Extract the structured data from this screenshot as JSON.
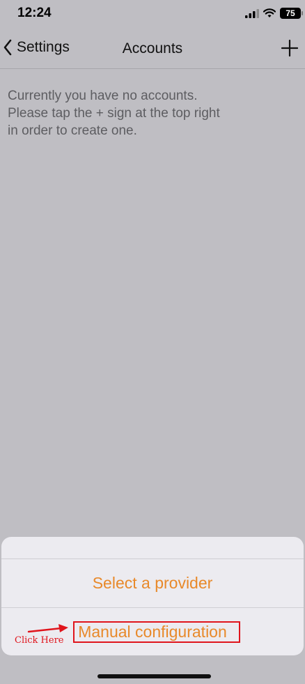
{
  "status_bar": {
    "time": "12:24",
    "battery_level": "75",
    "icons": [
      "signal-icon",
      "wifi-icon",
      "battery-icon"
    ]
  },
  "nav": {
    "back_label": "Settings",
    "title": "Accounts",
    "back_icon": "chevron-left-icon",
    "add_icon": "plus-icon"
  },
  "empty_message": {
    "lines": [
      "Currently you have no accounts.",
      "Please tap the + sign at the top right",
      "in order to create one."
    ]
  },
  "action_sheet": {
    "options": [
      {
        "label": "Select a provider"
      },
      {
        "label": "Manual configuration"
      }
    ]
  },
  "annotation": {
    "label": "Click Here",
    "color": "#e0141c"
  },
  "colors": {
    "accent": "#e8892a",
    "background": "#bfbec3",
    "sheet": "#ecebf0"
  }
}
